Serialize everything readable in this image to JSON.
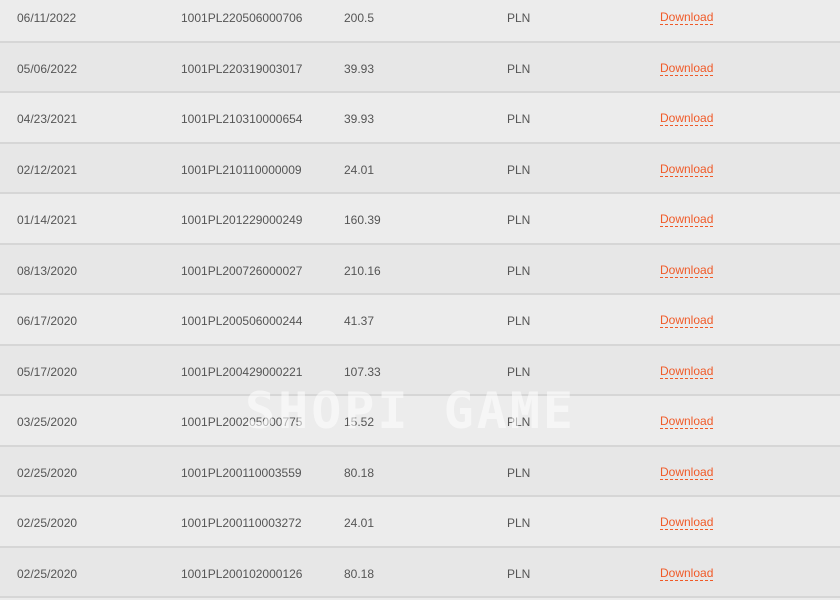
{
  "download_label": "Download",
  "watermark": "SHOPI GAME",
  "colors": {
    "link": "#f05a28",
    "text": "#555555",
    "divider": "#d6d6d6"
  },
  "rows": [
    {
      "date": "06/11/2022",
      "id": "1001PL220506000706",
      "amount": "200.5",
      "currency": "PLN"
    },
    {
      "date": "05/06/2022",
      "id": "1001PL220319003017",
      "amount": "39.93",
      "currency": "PLN"
    },
    {
      "date": "04/23/2021",
      "id": "1001PL210310000654",
      "amount": "39.93",
      "currency": "PLN"
    },
    {
      "date": "02/12/2021",
      "id": "1001PL210110000009",
      "amount": "24.01",
      "currency": "PLN"
    },
    {
      "date": "01/14/2021",
      "id": "1001PL201229000249",
      "amount": "160.39",
      "currency": "PLN"
    },
    {
      "date": "08/13/2020",
      "id": "1001PL200726000027",
      "amount": "210.16",
      "currency": "PLN"
    },
    {
      "date": "06/17/2020",
      "id": "1001PL200506000244",
      "amount": "41.37",
      "currency": "PLN"
    },
    {
      "date": "05/17/2020",
      "id": "1001PL200429000221",
      "amount": "107.33",
      "currency": "PLN"
    },
    {
      "date": "03/25/2020",
      "id": "1001PL200205000775",
      "amount": "15.52",
      "currency": "PLN"
    },
    {
      "date": "02/25/2020",
      "id": "1001PL200110003559",
      "amount": "80.18",
      "currency": "PLN"
    },
    {
      "date": "02/25/2020",
      "id": "1001PL200110003272",
      "amount": "24.01",
      "currency": "PLN"
    },
    {
      "date": "02/25/2020",
      "id": "1001PL200102000126",
      "amount": "80.18",
      "currency": "PLN"
    }
  ]
}
